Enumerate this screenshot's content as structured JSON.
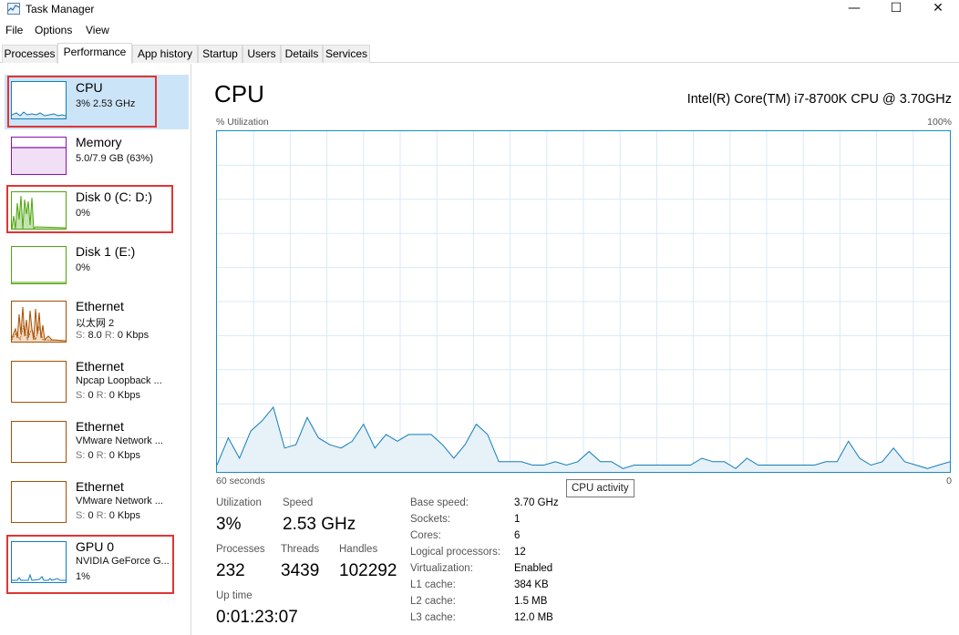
{
  "window": {
    "title": "Task Manager",
    "controls": {
      "minimize": "—",
      "maximize": "☐",
      "close": "✕"
    }
  },
  "menu": [
    "File",
    "Options",
    "View"
  ],
  "tabs": [
    "Processes",
    "Performance",
    "App history",
    "Startup",
    "Users",
    "Details",
    "Services"
  ],
  "active_tab": "Performance",
  "sidebar": {
    "items": [
      {
        "name": "CPU",
        "line1": "3%  2.53 GHz",
        "color": "#117dbb",
        "selected": true,
        "highlighted": true
      },
      {
        "name": "Memory",
        "line1": "5.0/7.9 GB (63%)",
        "color": "#8b12ae",
        "fill_level": 0.63
      },
      {
        "name": "Disk 0 (C: D:)",
        "line1": "0%",
        "color": "#4da60c",
        "highlighted": true
      },
      {
        "name": "Disk 1 (E:)",
        "line1": "0%",
        "color": "#4da60c"
      },
      {
        "name": "Ethernet",
        "line1": "以太网 2",
        "line2": {
          "s_label": "S:",
          "s_value": "8.0",
          "r_label": "R:",
          "r_value": "0 Kbps"
        },
        "color": "#a74f01"
      },
      {
        "name": "Ethernet",
        "line1": "Npcap Loopback ...",
        "line2": {
          "s_label": "S:",
          "s_value": "0",
          "r_label": "R:",
          "r_value": "0 Kbps"
        },
        "color": "#a74f01"
      },
      {
        "name": "Ethernet",
        "line1": "VMware Network ...",
        "line2": {
          "s_label": "S:",
          "s_value": "0",
          "r_label": "R:",
          "r_value": "0 Kbps"
        },
        "color": "#a74f01"
      },
      {
        "name": "Ethernet",
        "line1": "VMware Network ...",
        "line2": {
          "s_label": "S:",
          "s_value": "0",
          "r_label": "R:",
          "r_value": "0 Kbps"
        },
        "color": "#a74f01"
      },
      {
        "name": "GPU 0",
        "line1": "NVIDIA GeForce G...",
        "line2_text": "1%",
        "color": "#117dbb",
        "highlighted": true
      }
    ]
  },
  "main": {
    "title": "CPU",
    "cpu_model": "Intel(R) Core(TM) i7-8700K CPU @ 3.70GHz",
    "y_label": "% Utilization",
    "y_max_label": "100%",
    "x_left_label": "60 seconds",
    "x_right_label": "0",
    "tooltip": "CPU activity",
    "graph_color": "#117dbb",
    "utilization_history": [
      2,
      10,
      4,
      12,
      15,
      19,
      7,
      8,
      16,
      10,
      8,
      7,
      9,
      14,
      7,
      11,
      9,
      11,
      11,
      11,
      8,
      4,
      8,
      14,
      11,
      3,
      3,
      3,
      2,
      2,
      3,
      2,
      3,
      6,
      3,
      3,
      1,
      2,
      2,
      2,
      2,
      2,
      2,
      4,
      3,
      3,
      1,
      4,
      2,
      2,
      2,
      2,
      2,
      2,
      3,
      3,
      9,
      4,
      2,
      3,
      7,
      3,
      2,
      1,
      2,
      3
    ]
  },
  "stats": {
    "utilization": {
      "label": "Utilization",
      "value": "3%"
    },
    "speed": {
      "label": "Speed",
      "value": "2.53 GHz"
    },
    "processes": {
      "label": "Processes",
      "value": "232"
    },
    "threads": {
      "label": "Threads",
      "value": "3439"
    },
    "handles": {
      "label": "Handles",
      "value": "102292"
    },
    "uptime": {
      "label": "Up time",
      "value": "0:01:23:07"
    }
  },
  "specs": [
    {
      "label": "Base speed:",
      "value": "3.70 GHz"
    },
    {
      "label": "Sockets:",
      "value": "1"
    },
    {
      "label": "Cores:",
      "value": "6"
    },
    {
      "label": "Logical processors:",
      "value": "12"
    },
    {
      "label": "Virtualization:",
      "value": "Enabled"
    },
    {
      "label": "L1 cache:",
      "value": "384 KB"
    },
    {
      "label": "L2 cache:",
      "value": "1.5 MB"
    },
    {
      "label": "L3 cache:",
      "value": "12.0 MB"
    }
  ]
}
